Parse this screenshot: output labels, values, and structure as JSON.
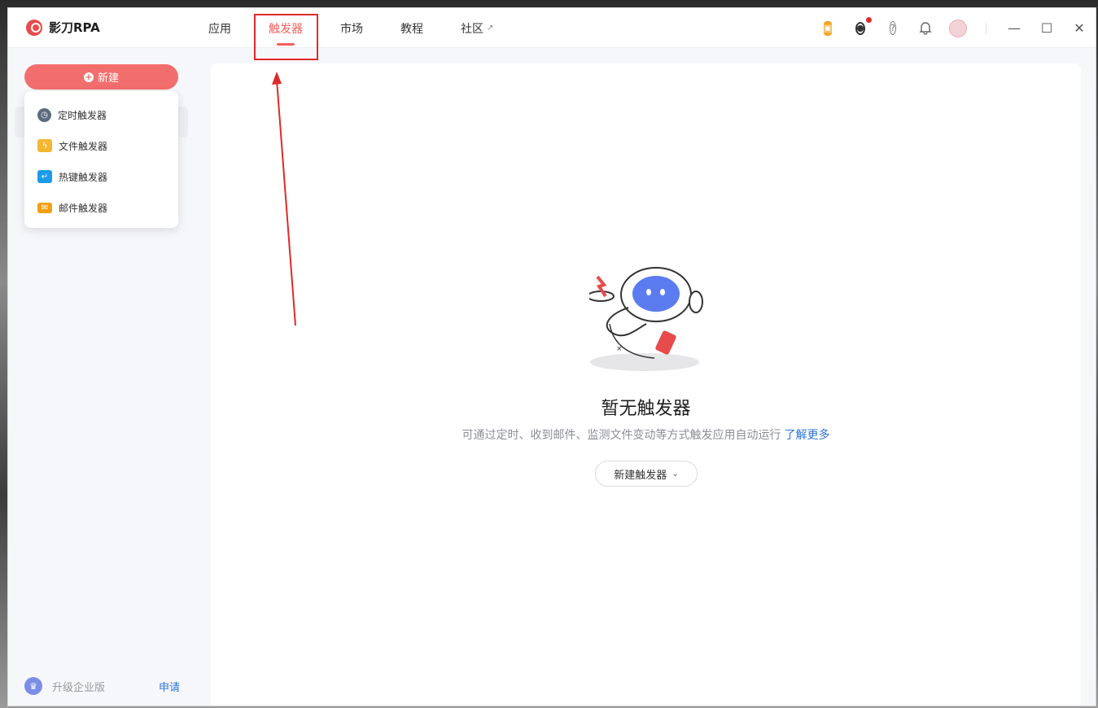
{
  "app": {
    "name": "影刀RPA"
  },
  "nav": {
    "tabs": [
      {
        "label": "应用"
      },
      {
        "label": "触发器",
        "active": true
      },
      {
        "label": "市场"
      },
      {
        "label": "教程"
      },
      {
        "label": "社区",
        "external_icon": "external-link-icon"
      }
    ]
  },
  "toolbar": {
    "icons": [
      "gift-icon",
      "eye-icon",
      "help-icon",
      "bell-icon",
      "avatar-icon"
    ],
    "window_controls": [
      "minimize-icon",
      "maximize-icon",
      "close-icon"
    ]
  },
  "sidebar": {
    "new_button": "新建",
    "dropdown": [
      {
        "label": "定时触发器",
        "icon": "clock-icon"
      },
      {
        "label": "文件触发器",
        "icon": "file-bolt-icon"
      },
      {
        "label": "热键触发器",
        "icon": "hotkey-icon"
      },
      {
        "label": "邮件触发器",
        "icon": "mail-icon"
      }
    ],
    "upgrade_label": "升级企业版",
    "apply_label": "申请"
  },
  "main": {
    "empty_title": "暂无触发器",
    "empty_desc": "可通过定时、收到邮件、监测文件变动等方式触发应用自动运行",
    "learn_more": "了解更多",
    "new_trigger_button": "新建触发器"
  },
  "colors": {
    "accent": "#f25f5c",
    "link": "#2e74d9",
    "annotation": "#e02a2a"
  }
}
